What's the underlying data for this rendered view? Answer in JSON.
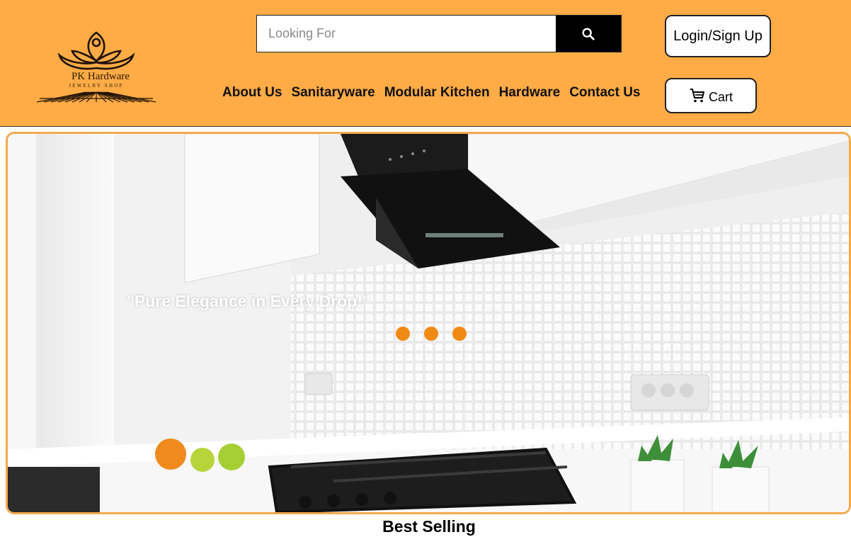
{
  "brand": {
    "name": "PK Hardware",
    "tagline": "JEWELRY SHOP",
    "logo_icon": "lotus-icon",
    "accent_color": "#ffab46"
  },
  "search": {
    "placeholder": "Looking For",
    "value": "",
    "button_icon": "search-icon"
  },
  "account": {
    "login_label": "Login/Sign Up",
    "cart_label": "Cart",
    "cart_icon": "cart-icon"
  },
  "nav": {
    "items": [
      {
        "label": "About Us"
      },
      {
        "label": "Sanitaryware"
      },
      {
        "label": "Modular Kitchen"
      },
      {
        "label": "Hardware"
      },
      {
        "label": "Contact Us"
      }
    ]
  },
  "hero": {
    "caption": "\"Pure Elegance in Every Drop!\"",
    "slide_count": 3,
    "dot_color": "#f08a12",
    "border_color": "#f5a94e"
  },
  "sections": {
    "best_selling_title": "Best Selling"
  }
}
